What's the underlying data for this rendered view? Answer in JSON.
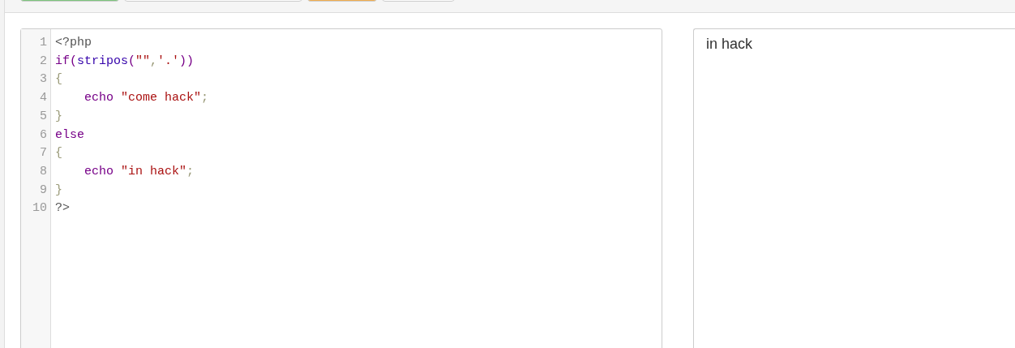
{
  "toolbar_buttons": [
    {
      "color": "#7cc47c"
    },
    {
      "color": "#ffffff"
    },
    {
      "color": "#f0ad4e"
    },
    {
      "color": "#ffffff"
    }
  ],
  "editor": {
    "lines": [
      {
        "number": "1",
        "indented": false,
        "tokens": [
          {
            "text": "<?php",
            "kind": "meta"
          }
        ]
      },
      {
        "number": "2",
        "indented": false,
        "tokens": [
          {
            "text": "if",
            "kind": "keyword"
          },
          {
            "text": "(",
            "kind": "plain"
          },
          {
            "text": "stripos",
            "kind": "builtin"
          },
          {
            "text": "(",
            "kind": "plain"
          },
          {
            "text": "\"\"",
            "kind": "string"
          },
          {
            "text": ",",
            "kind": "punct"
          },
          {
            "text": "'.'",
            "kind": "string"
          },
          {
            "text": "))",
            "kind": "plain"
          }
        ]
      },
      {
        "number": "3",
        "indented": false,
        "tokens": [
          {
            "text": "{",
            "kind": "bracket"
          }
        ]
      },
      {
        "number": "4",
        "indented": true,
        "tokens": [
          {
            "text": "echo",
            "kind": "keyword"
          },
          {
            "text": " \"come hack\"",
            "kind": "string"
          },
          {
            "text": ";",
            "kind": "punct"
          }
        ]
      },
      {
        "number": "5",
        "indented": false,
        "tokens": [
          {
            "text": "}",
            "kind": "bracket"
          }
        ]
      },
      {
        "number": "6",
        "indented": false,
        "tokens": [
          {
            "text": "else",
            "kind": "keyword"
          }
        ]
      },
      {
        "number": "7",
        "indented": false,
        "tokens": [
          {
            "text": "{",
            "kind": "bracket"
          }
        ]
      },
      {
        "number": "8",
        "indented": true,
        "tokens": [
          {
            "text": "echo",
            "kind": "keyword"
          },
          {
            "text": " \"in hack\"",
            "kind": "string"
          },
          {
            "text": ";",
            "kind": "punct"
          }
        ]
      },
      {
        "number": "9",
        "indented": false,
        "tokens": [
          {
            "text": "}",
            "kind": "bracket"
          }
        ]
      },
      {
        "number": "10",
        "indented": false,
        "tokens": [
          {
            "text": "?>",
            "kind": "meta"
          }
        ]
      }
    ]
  },
  "output": {
    "text": "in hack"
  }
}
